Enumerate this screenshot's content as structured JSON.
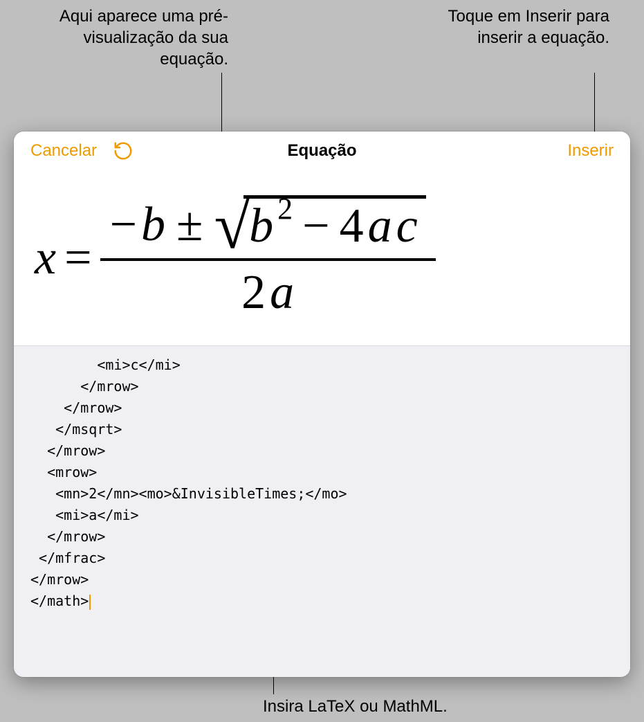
{
  "callouts": {
    "preview_label": "Aqui aparece uma pré-visualização da sua equação.",
    "insert_label": "Toque em Inserir para inserir a equação.",
    "input_label": "Insira LaTeX ou MathML."
  },
  "toolbar": {
    "cancel": "Cancelar",
    "title": "Equação",
    "insert": "Inserir"
  },
  "equation": {
    "lhs": "x",
    "equals": "=",
    "numerator_minus": "−",
    "numerator_b": "b",
    "numerator_pm": "±",
    "sqrt_b": "b",
    "sqrt_exp": "2",
    "sqrt_minus": "−",
    "sqrt_4": "4",
    "sqrt_a": "a",
    "sqrt_c": "c",
    "denom_2": "2",
    "denom_a": "a"
  },
  "code": {
    "text": "        <mi>c</mi>\n      </mrow>\n    </mrow>\n   </msqrt>\n  </mrow>\n  <mrow>\n   <mn>2</mn><mo>&InvisibleTimes;</mo>\n   <mi>a</mi>\n  </mrow>\n </mfrac>\n</mrow>\n</math>"
  }
}
